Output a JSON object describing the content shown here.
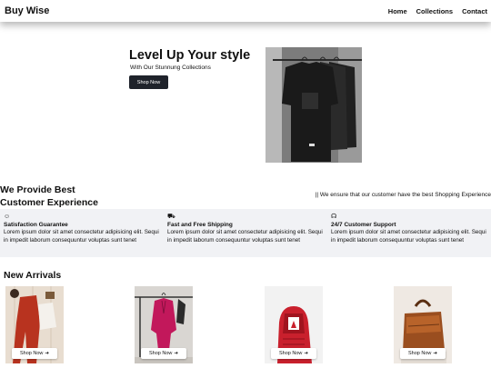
{
  "navbar": {
    "brand": "Buy Wise",
    "links": [
      "Home",
      "Collections",
      "Contact"
    ]
  },
  "hero": {
    "title": "Level Up Your style",
    "subtitle": "With Our Stunnung Collections",
    "button": "Shop Now"
  },
  "experience": {
    "title_line1": "We Provide Best",
    "title_line2": "Customer Experience",
    "tagline": "|| We ensure that our customer have the best Shopping Experience"
  },
  "features": [
    {
      "icon": "smile-icon",
      "glyph": "☺",
      "title": "Satisfaction Guarantee",
      "text": "Lorem ipsum dolor sit amet consectetur adipisicing elit. Sequi in impedit laborum consequuntur voluptas sunt tenet"
    },
    {
      "icon": "truck-icon",
      "glyph": "⛟",
      "title": "Fast and Free Shipping",
      "text": "Lorem ipsum dolor sit amet consectetur adipisicing elit. Sequi in impedit laborum consequuntur voluptas sunt tenet"
    },
    {
      "icon": "headset-icon",
      "glyph": "☊",
      "title": "24/7 Customer Support",
      "text": "Lorem ipsum dolor sit amet consectetur adipisicing elit. Sequi in impedit laborum consequuntur voluptas sunt tenet"
    }
  ],
  "arrivals": {
    "title": "New Arrivals",
    "shop_label": "Shop Now",
    "arrow": "➔"
  },
  "colors": {
    "dark_button": "#1f232b",
    "feature_band": "#f1f2f5"
  }
}
